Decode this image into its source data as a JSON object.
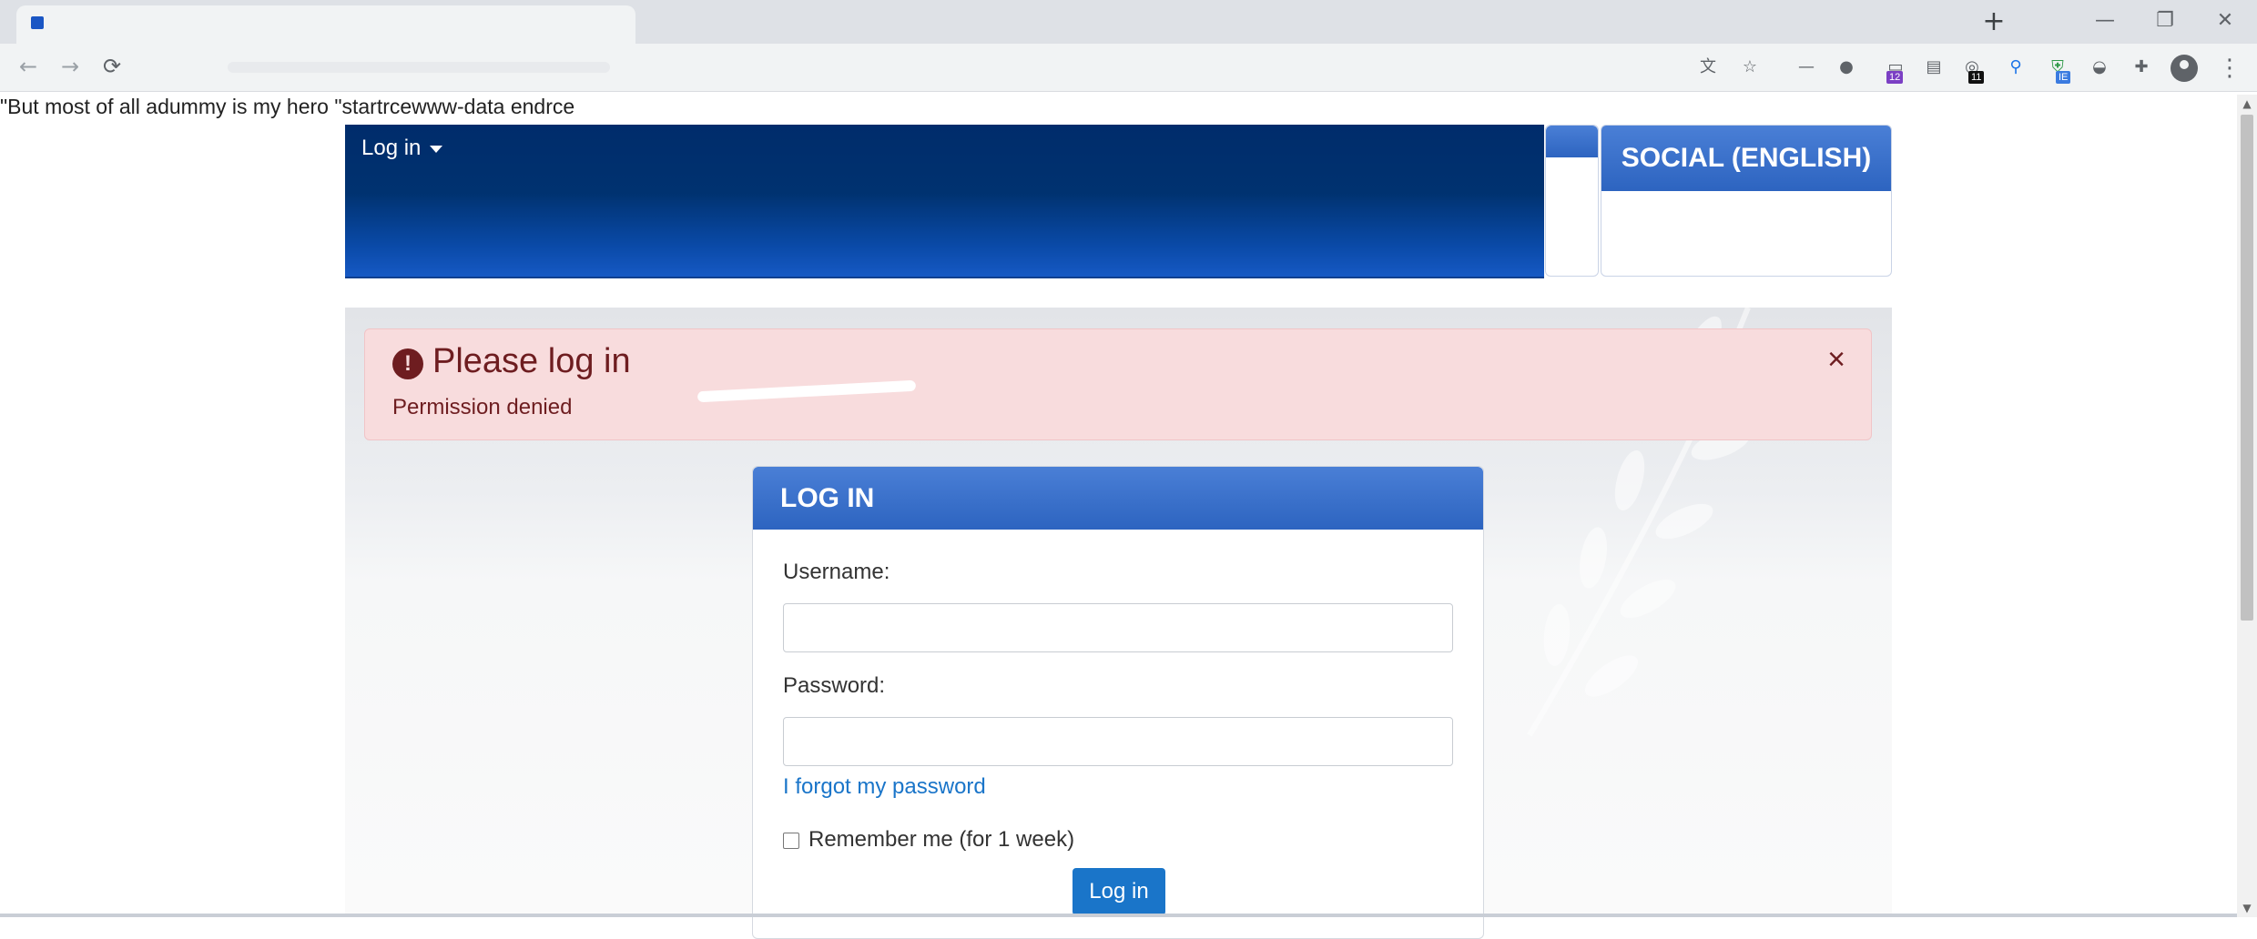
{
  "browser": {
    "new_tab_symbol": "+",
    "window_controls": {
      "minimize": "—",
      "restore": "❐",
      "close": "✕"
    },
    "nav": {
      "back": "←",
      "forward": "→",
      "reload": "⟳"
    },
    "extension_badges": [
      "12",
      "11",
      "IE"
    ],
    "menu_symbol": "⋮"
  },
  "page": {
    "debug_text": "\"But most of all adummy is my hero \"startrcewww-data endrce",
    "user_menu_label": "Log in",
    "social_block_title": "SOCIAL (ENGLISH)",
    "alert": {
      "icon": "!",
      "title": "Please log in",
      "message": "Permission denied",
      "close_symbol": "×"
    },
    "login": {
      "header": "LOG IN",
      "username_label": "Username:",
      "username_value": "",
      "password_label": "Password:",
      "password_value": "",
      "forgot_link": "I forgot my password",
      "remember_label": "Remember me (for 1 week)",
      "remember_checked": false,
      "submit_label": "Log in"
    }
  },
  "colors": {
    "header_navy": "#002c6b",
    "block_header_blue": "#3a70cc",
    "alert_bg": "#f8dcdd",
    "alert_text": "#6e1d20",
    "link_blue": "#1a75c9"
  }
}
